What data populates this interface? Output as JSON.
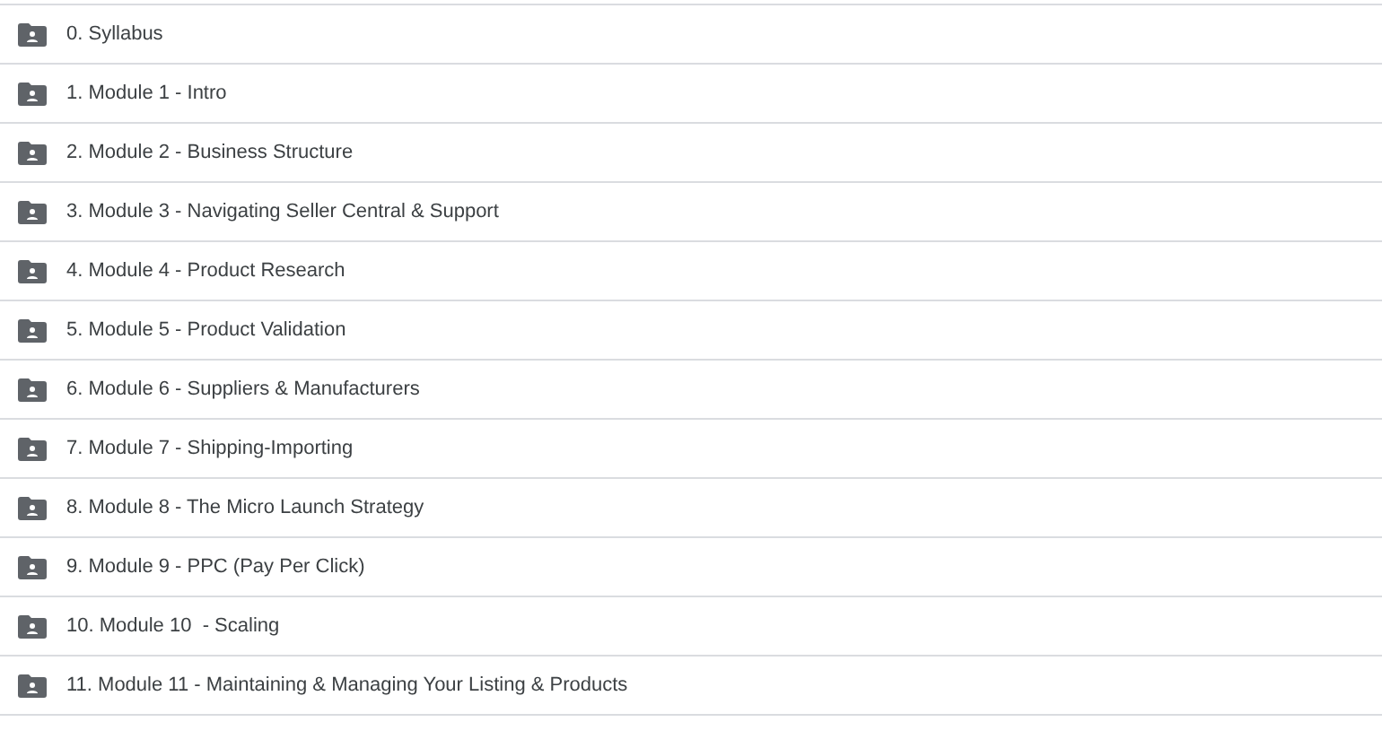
{
  "folders": [
    {
      "name": "0. Syllabus"
    },
    {
      "name": "1. Module 1 - Intro"
    },
    {
      "name": "2. Module 2 - Business Structure"
    },
    {
      "name": "3. Module 3 - Navigating Seller Central & Support"
    },
    {
      "name": "4. Module 4 - Product Research"
    },
    {
      "name": "5. Module 5 - Product Validation"
    },
    {
      "name": "6. Module 6 - Suppliers & Manufacturers"
    },
    {
      "name": "7. Module 7 - Shipping-Importing"
    },
    {
      "name": "8. Module 8 - The Micro Launch Strategy"
    },
    {
      "name": "9. Module 9 - PPC (Pay Per Click)"
    },
    {
      "name": "10. Module 10  - Scaling"
    },
    {
      "name": "11. Module 11 - Maintaining & Managing Your Listing & Products"
    }
  ]
}
